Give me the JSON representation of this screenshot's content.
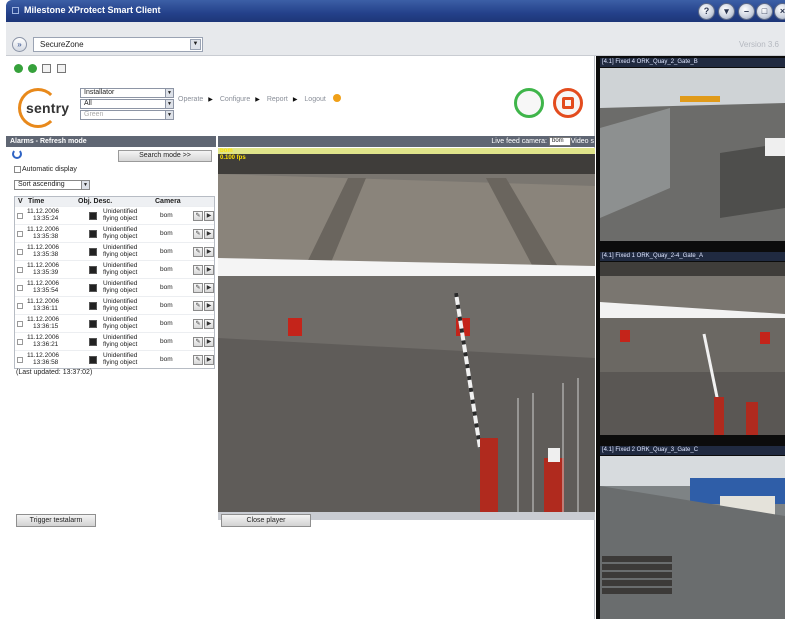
{
  "window": {
    "title": "Milestone XProtect Smart Client",
    "version": "Version 3.6"
  },
  "address": {
    "zone": "SecureZone"
  },
  "toolbar": {
    "role_select": "Installator",
    "group_select": "All",
    "status_select": "Green",
    "menu": [
      "Operate",
      "Configure",
      "Report",
      "Logout"
    ],
    "logo_text": "sentry"
  },
  "alarms": {
    "header": "Alarms - Refresh mode",
    "search_button": "Search mode >>",
    "auto_display": "Automatic display",
    "sort": "Sort ascending",
    "columns": [
      "V",
      "Time",
      "Obj. Desc.",
      "Camera"
    ],
    "rows": [
      {
        "date": "11.12.2006",
        "time": "13:35:24",
        "desc1": "Unidentified",
        "desc2": "flying object",
        "camera": "bom"
      },
      {
        "date": "11.12.2006",
        "time": "13:35:38",
        "desc1": "Unidentified",
        "desc2": "flying object",
        "camera": "bom"
      },
      {
        "date": "11.12.2006",
        "time": "13:35:38",
        "desc1": "Unidentified",
        "desc2": "flying object",
        "camera": "bom"
      },
      {
        "date": "11.12.2006",
        "time": "13:35:39",
        "desc1": "Unidentified",
        "desc2": "flying object",
        "camera": "bom"
      },
      {
        "date": "11.12.2006",
        "time": "13:35:54",
        "desc1": "Unidentified",
        "desc2": "flying object",
        "camera": "bom"
      },
      {
        "date": "11.12.2006",
        "time": "13:36:11",
        "desc1": "Unidentified",
        "desc2": "flying object",
        "camera": "bom"
      },
      {
        "date": "11.12.2006",
        "time": "13:36:15",
        "desc1": "Unidentified",
        "desc2": "flying object",
        "camera": "bom"
      },
      {
        "date": "11.12.2006",
        "time": "13:36:21",
        "desc1": "Unidentified",
        "desc2": "flying object",
        "camera": "bom"
      },
      {
        "date": "11.12.2006",
        "time": "13:36:58",
        "desc1": "Unidentified",
        "desc2": "flying object",
        "camera": "bom"
      }
    ],
    "last_updated": "(Last updated: 13:37:02)",
    "trigger_button": "Trigger testalarm"
  },
  "feed": {
    "live_label": "Live feed camera:",
    "camera": "bom",
    "video_label": "Video s",
    "overlay_name": "bom",
    "overlay_fps": "0.100 fps",
    "close_button": "Close player"
  },
  "cameras": [
    {
      "title": "[4.1] Fixed 4 ORK_Quay_2_Gate_B"
    },
    {
      "title": "[4.1] Fixed 1 ORK_Quay_2-4_Gate_A"
    },
    {
      "title": "[4.1] Fixed 2 ORK_Quay_3_Gate_C"
    }
  ],
  "icons": {
    "nav": "forward-nav-icon",
    "help": "help-icon",
    "refresh": "refresh-icon",
    "acknowledge": "acknowledge-icon",
    "play": "play-icon"
  },
  "colors": {
    "title_bar": "#24418a",
    "panel_header": "#5f6673",
    "accept_green": "#3fb54a",
    "stop_red": "#e34c1e",
    "logo_orange": "#e8891b",
    "overlay_yellow": "#ffe300"
  }
}
